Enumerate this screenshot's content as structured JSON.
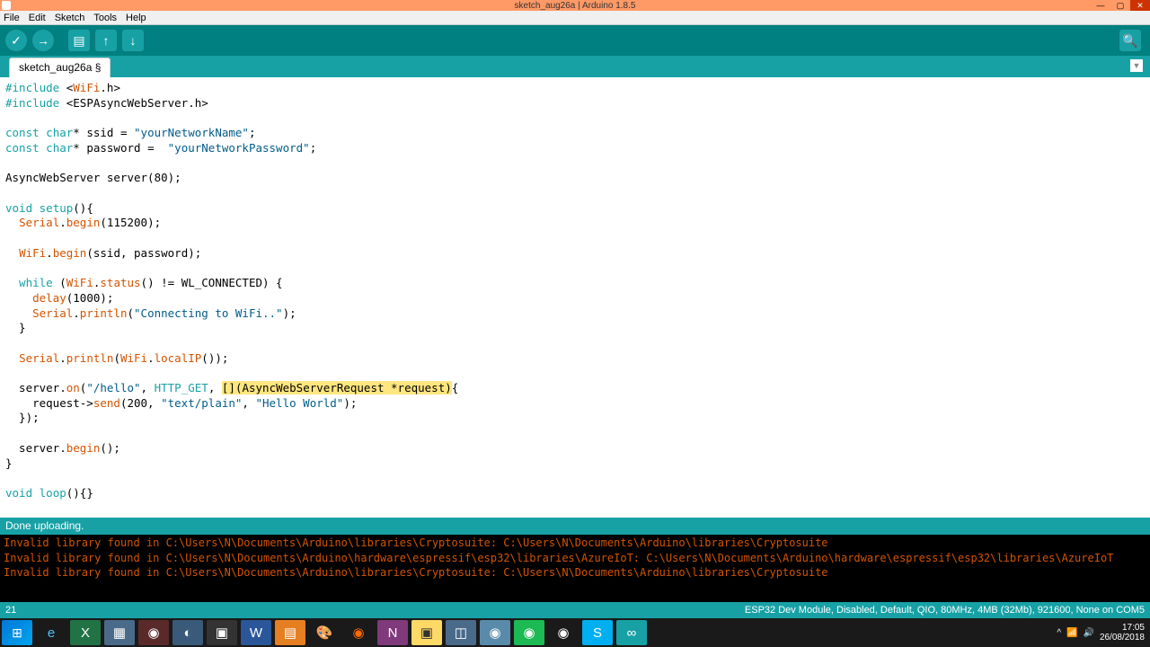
{
  "window": {
    "title": "sketch_aug26a | Arduino 1.8.5"
  },
  "menu": {
    "file": "File",
    "edit": "Edit",
    "sketch": "Sketch",
    "tools": "Tools",
    "help": "Help"
  },
  "tab": {
    "name": "sketch_aug26a §"
  },
  "code": {
    "l1a": "#include",
    "l1b": " <",
    "l1c": "WiFi",
    "l1d": ".h>",
    "l2a": "#include",
    "l2b": " <ESPAsyncWebServer.h>",
    "l3a": "const",
    "l3b": " char",
    "l3c": "* ssid = ",
    "l3d": "\"yourNetworkName\"",
    "l3e": ";",
    "l4a": "const",
    "l4b": " char",
    "l4c": "* password =  ",
    "l4d": "\"yourNetworkPassword\"",
    "l4e": ";",
    "l5": "AsyncWebServer server(80);",
    "l6a": "void",
    "l6b": " ",
    "l6c": "setup",
    "l6d": "(){",
    "l7a": "  ",
    "l7b": "Serial",
    "l7c": ".",
    "l7d": "begin",
    "l7e": "(115200);",
    "l8a": "  ",
    "l8b": "WiFi",
    "l8c": ".",
    "l8d": "begin",
    "l8e": "(ssid, password);",
    "l9a": "  while",
    "l9b": " (",
    "l9c": "WiFi",
    "l9d": ".",
    "l9e": "status",
    "l9f": "() != WL_CONNECTED) {",
    "l10a": "    ",
    "l10b": "delay",
    "l10c": "(1000);",
    "l11a": "    ",
    "l11b": "Serial",
    "l11c": ".",
    "l11d": "println",
    "l11e": "(",
    "l11f": "\"Connecting to WiFi..\"",
    "l11g": ");",
    "l12": "  }",
    "l13a": "  ",
    "l13b": "Serial",
    "l13c": ".",
    "l13d": "println",
    "l13e": "(",
    "l13f": "WiFi",
    "l13g": ".",
    "l13h": "localIP",
    "l13i": "());",
    "l14a": "  server.",
    "l14b": "on",
    "l14c": "(",
    "l14d": "\"/hello\"",
    "l14e": ", ",
    "l14f": "HTTP_GET",
    "l14g": ", ",
    "l14h": "[](AsyncWebServerRequest *request)",
    "l14i": "{",
    "l15a": "    request->",
    "l15b": "send",
    "l15c": "(200, ",
    "l15d": "\"text/plain\"",
    "l15e": ", ",
    "l15f": "\"Hello World\"",
    "l15g": ");",
    "l16": "  });",
    "l17a": "  server.",
    "l17b": "begin",
    "l17c": "();",
    "l18": "}",
    "l19a": "void",
    "l19b": " ",
    "l19c": "loop",
    "l19d": "(){}"
  },
  "status": {
    "message": "Done uploading."
  },
  "console": {
    "line1": "Invalid library found in C:\\Users\\N\\Documents\\Arduino\\libraries\\Cryptosuite: C:\\Users\\N\\Documents\\Arduino\\libraries\\Cryptosuite",
    "line2": "Invalid library found in C:\\Users\\N\\Documents\\Arduino\\hardware\\espressif\\esp32\\libraries\\AzureIoT: C:\\Users\\N\\Documents\\Arduino\\hardware\\espressif\\esp32\\libraries\\AzureIoT",
    "line3": "Invalid library found in C:\\Users\\N\\Documents\\Arduino\\libraries\\Cryptosuite: C:\\Users\\N\\Documents\\Arduino\\libraries\\Cryptosuite"
  },
  "bottom": {
    "line": "21",
    "board": "ESP32 Dev Module, Disabled, Default, QIO, 80MHz, 4MB (32Mb), 921600, None on COM5"
  },
  "tray": {
    "time": "17:05",
    "date": "26/08/2018"
  }
}
